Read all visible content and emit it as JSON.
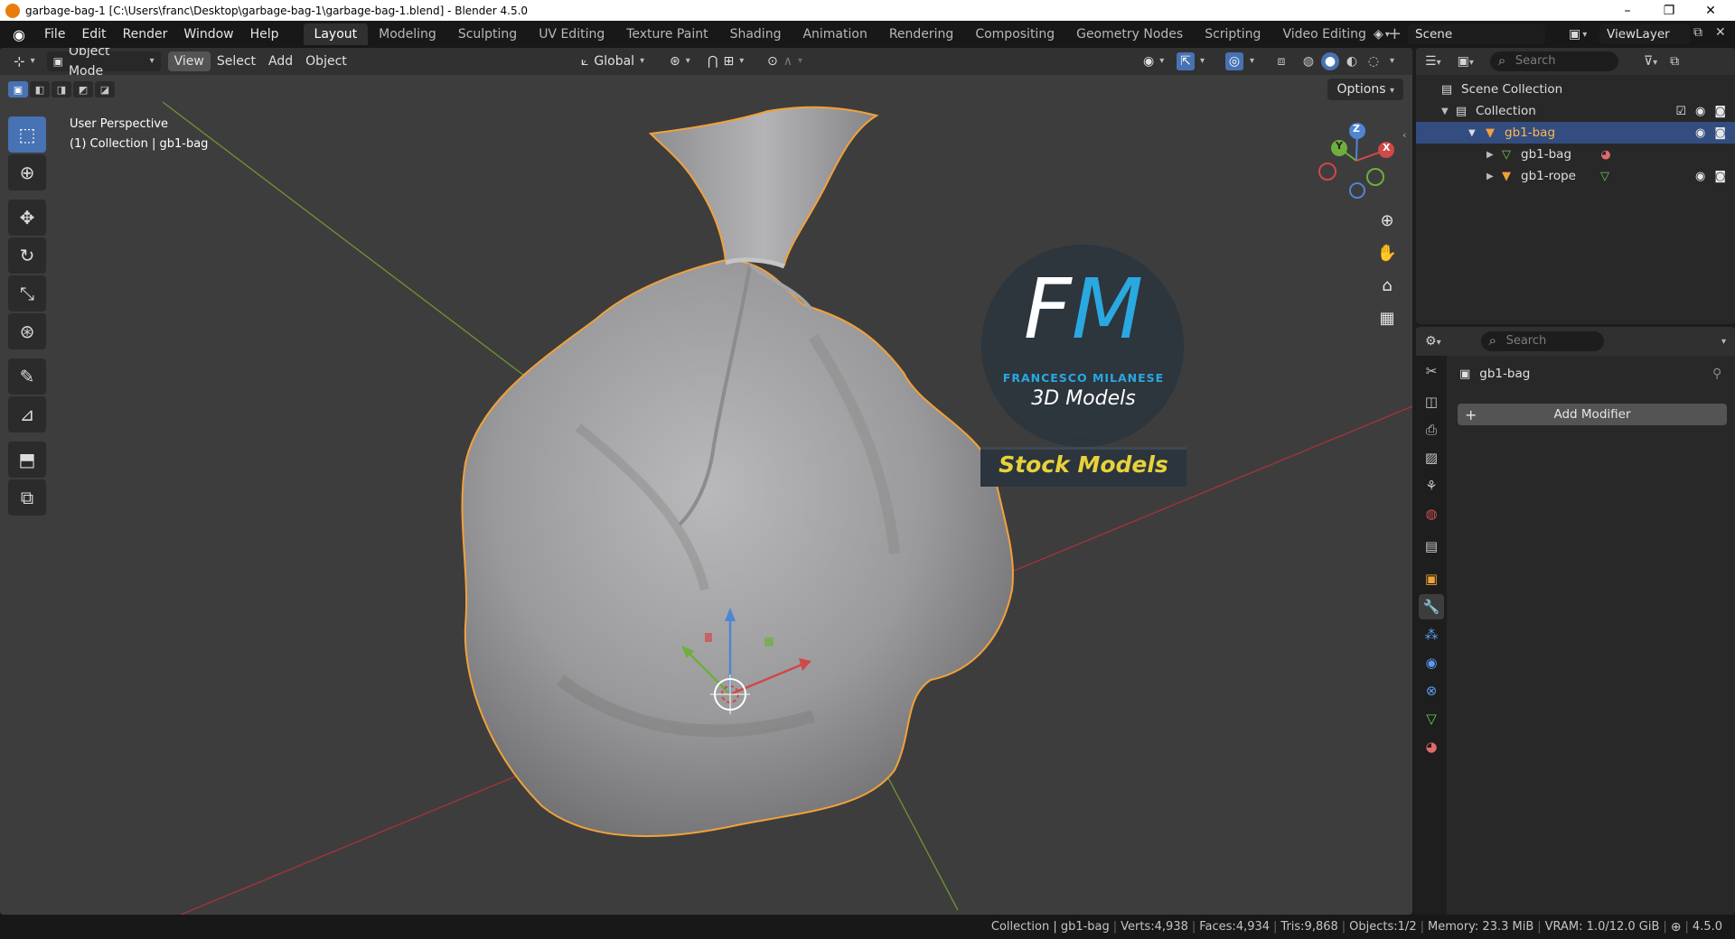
{
  "window": {
    "title": "garbage-bag-1 [C:\\Users\\franc\\Desktop\\garbage-bag-1\\garbage-bag-1.blend] - Blender 4.5.0",
    "minimize": "–",
    "restore": "❐",
    "close": "✕"
  },
  "menu": [
    "File",
    "Edit",
    "Render",
    "Window",
    "Help"
  ],
  "workspaces": [
    "Layout",
    "Modeling",
    "Sculpting",
    "UV Editing",
    "Texture Paint",
    "Shading",
    "Animation",
    "Rendering",
    "Compositing",
    "Geometry Nodes",
    "Scripting",
    "Video Editing"
  ],
  "workspace_add": "+",
  "scene": {
    "label": "Scene",
    "view_layer": "ViewLayer"
  },
  "viewport": {
    "mode": "Object Mode",
    "menus": [
      "View",
      "Select",
      "Add",
      "Object"
    ],
    "transform_orientation": "Global",
    "options": "Options",
    "perspective": "User Perspective",
    "collection_info": "(1) Collection | gb1-bag",
    "gizmo_axes": {
      "x": "X",
      "y": "Y",
      "z": "Z"
    }
  },
  "watermark": {
    "letters": "FM",
    "name": "FRANCESCO MILANESE",
    "subtitle": "3D Models",
    "banner": "Stock Models"
  },
  "outliner": {
    "search_placeholder": "Search",
    "rows": [
      {
        "label": "Scene Collection"
      },
      {
        "label": "Collection"
      },
      {
        "label": "gb1-bag"
      },
      {
        "label": "gb1-bag"
      },
      {
        "label": "gb1-rope"
      }
    ]
  },
  "properties": {
    "search_placeholder": "Search",
    "object_name": "gb1-bag",
    "add_modifier": "Add Modifier"
  },
  "statusbar": {
    "collection": "Collection | gb1-bag",
    "verts": "Verts:4,938",
    "faces": "Faces:4,934",
    "tris": "Tris:9,868",
    "objects": "Objects:1/2",
    "memory": "Memory: 23.3 MiB",
    "vram": "VRAM: 1.0/12.0 GiB",
    "version": "4.5.0"
  },
  "colors": {
    "accent": "#4772b3",
    "selection_outline": "#f2a13a",
    "selected_row": "#334d80",
    "viewport_bg": "#3d3d3d"
  }
}
